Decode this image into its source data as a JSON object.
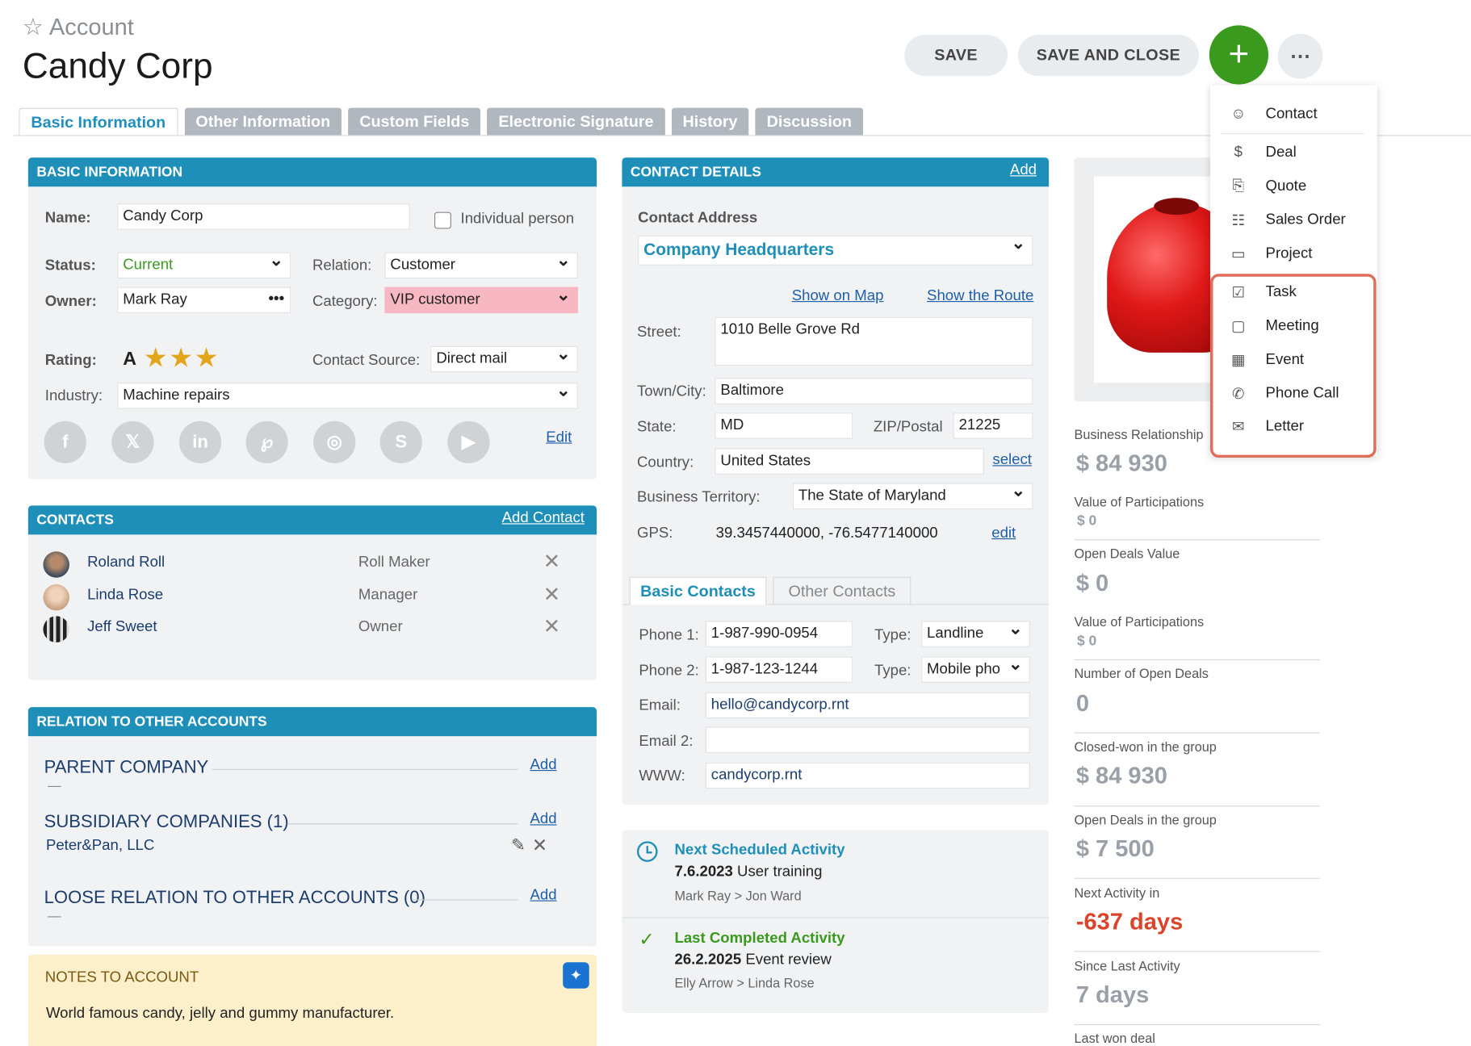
{
  "header": {
    "breadcrumb": "Account",
    "title": "Candy Corp",
    "save": "SAVE",
    "save_close": "SAVE AND CLOSE",
    "plus": "+",
    "more": "⋯"
  },
  "tabs": [
    "Basic Information",
    "Other Information",
    "Custom Fields",
    "Electronic Signature",
    "History",
    "Discussion"
  ],
  "basic": {
    "head": "BASIC INFORMATION",
    "name_lbl": "Name:",
    "name": "Candy Corp",
    "individual": "Individual person",
    "status_lbl": "Status:",
    "status": "Current",
    "relation_lbl": "Relation:",
    "relation": "Customer",
    "owner_lbl": "Owner:",
    "owner": "Mark Ray",
    "owner_more": "•••",
    "category_lbl": "Category:",
    "category": "VIP customer",
    "rating_lbl": "Rating:",
    "rating_letter": "A",
    "rating_stars": "★★★",
    "source_lbl": "Contact Source:",
    "source": "Direct mail",
    "industry_lbl": "Industry:",
    "industry": "Machine repairs",
    "edit": "Edit",
    "social": [
      "f",
      "𝕏",
      "in",
      "℘",
      "◎",
      "S",
      "▶"
    ]
  },
  "contacts": {
    "head": "CONTACTS",
    "add": "Add Contact",
    "rows": [
      {
        "name": "Roland Roll",
        "role": "Roll Maker"
      },
      {
        "name": "Linda Rose",
        "role": "Manager"
      },
      {
        "name": "Jeff Sweet",
        "role": "Owner"
      }
    ],
    "remove": "✕"
  },
  "relations": {
    "head": "RELATION TO OTHER ACCOUNTS",
    "parent": "PARENT COMPANY",
    "parent_val": "—",
    "subs": "SUBSIDIARY COMPANIES (1)",
    "subs_val": "Peter&Pan, LLC",
    "loose": "LOOSE RELATION TO OTHER ACCOUNTS (0)",
    "loose_val": "—",
    "add": "Add",
    "edit_icon": "✎",
    "remove": "✕"
  },
  "notes": {
    "head": "NOTES TO ACCOUNT",
    "text": "World famous candy, jelly and gummy manufacturer."
  },
  "contact_details": {
    "head": "CONTACT DETAILS",
    "add": "Add",
    "address_lbl": "Contact Address",
    "address": "Company Headquarters",
    "show_map": "Show on Map",
    "show_route": "Show the Route",
    "street_lbl": "Street:",
    "street": "1010 Belle Grove Rd",
    "town_lbl": "Town/City:",
    "town": "Baltimore",
    "state_lbl": "State:",
    "state": "MD",
    "zip_lbl": "ZIP/Postal",
    "zip": "21225",
    "country_lbl": "Country:",
    "country": "United States",
    "select": "select",
    "territory_lbl": "Business Territory:",
    "territory": "The State of Maryland",
    "gps_lbl": "GPS:",
    "gps": "39.3457440000, -76.5477140000",
    "gps_edit": "edit",
    "tab_basic": "Basic Contacts",
    "tab_other": "Other Contacts",
    "phone1_lbl": "Phone 1:",
    "phone1": "1-987-990-0954",
    "type_lbl": "Type:",
    "type1": "Landline",
    "phone2_lbl": "Phone 2:",
    "phone2": "1-987-123-1244",
    "type2": "Mobile pho",
    "email_lbl": "Email:",
    "email": "hello@candycorp.rnt",
    "email2_lbl": "Email 2:",
    "email2": "",
    "www_lbl": "WWW:",
    "www": "candycorp.rnt"
  },
  "activity": {
    "next_title": "Next Scheduled Activity",
    "next_date": "7.6.2023",
    "next_text": "User training",
    "next_people": "Mark Ray > Jon Ward",
    "last_title": "Last Completed Activity",
    "last_date": "26.2.2025",
    "last_text": "Event review",
    "last_people": "Elly Arrow > Linda Rose"
  },
  "stats": [
    {
      "label": "Business Relationship",
      "value": "$ 84 930",
      "style": "big"
    },
    {
      "label": "Value of Participations",
      "value": "$ 0",
      "style": "small"
    },
    {
      "label": "Open Deals Value",
      "value": "$ 0",
      "style": "big"
    },
    {
      "label": "Value of Participations",
      "value": "$ 0",
      "style": "small"
    },
    {
      "label": "Number of Open Deals",
      "value": "0",
      "style": "big"
    },
    {
      "label": "Closed-won in the group",
      "value": "$ 84 930",
      "style": "big"
    },
    {
      "label": "Open Deals in the group",
      "value": "$ 7 500",
      "style": "big"
    },
    {
      "label": "Next Activity in",
      "value": "-637 days",
      "style": "red"
    },
    {
      "label": "Since Last Activity",
      "value": "7 days",
      "style": "big"
    },
    {
      "label": "Last won deal",
      "value": "",
      "style": "big"
    }
  ],
  "menu": [
    {
      "label": "Contact",
      "icon": "person-icon",
      "glyph": "☺"
    },
    {
      "label": "Deal",
      "icon": "dollar-icon",
      "glyph": "$"
    },
    {
      "label": "Quote",
      "icon": "quote-icon",
      "glyph": "⎘"
    },
    {
      "label": "Sales Order",
      "icon": "clipboard-icon",
      "glyph": "☷"
    },
    {
      "label": "Project",
      "icon": "folder-icon",
      "glyph": "▭"
    },
    {
      "label": "Task",
      "icon": "task-check-icon",
      "glyph": "☑"
    },
    {
      "label": "Meeting",
      "icon": "meeting-icon",
      "glyph": "▢"
    },
    {
      "label": "Event",
      "icon": "calendar-icon",
      "glyph": "▦"
    },
    {
      "label": "Phone Call",
      "icon": "phone-icon",
      "glyph": "✆"
    },
    {
      "label": "Letter",
      "icon": "envelope-icon",
      "glyph": "✉"
    }
  ],
  "colors": {
    "accent": "#1e8fb8",
    "green": "#3a9a1e",
    "highlight": "#e06e5a",
    "category_bg": "#f7b7c3",
    "red": "#d9442b"
  }
}
